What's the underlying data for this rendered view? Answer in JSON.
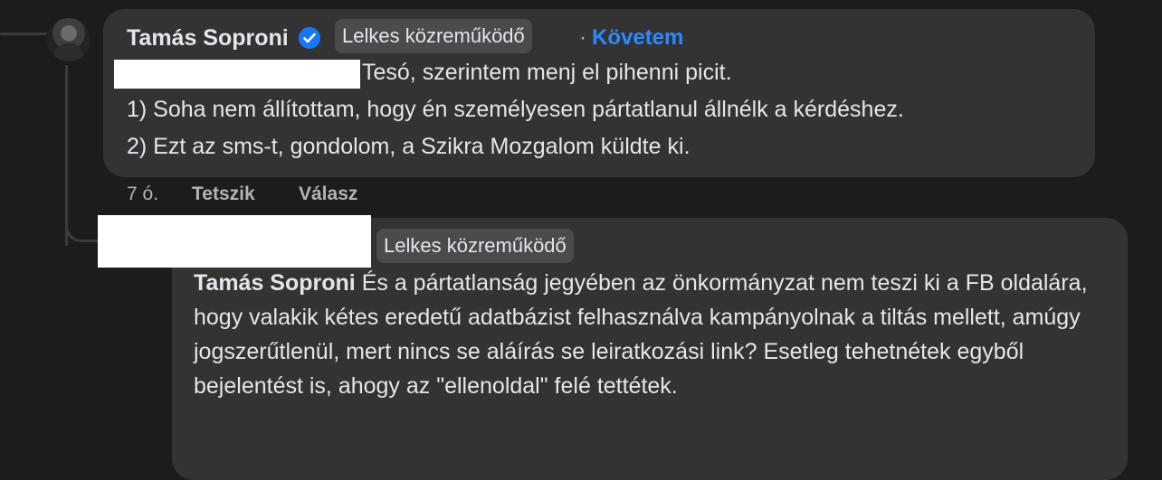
{
  "comment": {
    "author": "Tamás Soproni",
    "badge": "Lelkes közreműködő",
    "separator": "·",
    "follow_label": "Követem",
    "lines": [
      "Tesó, szerintem menj el pihenni picit.",
      "1) Soha nem állítottam, hogy én személyesen pártatlanul állnélk a kérdéshez.",
      "2) Ezt az sms-t, gondolom, a Szikra Mozgalom küldte ki."
    ],
    "time": "7 ó.",
    "like_label": "Tetszik",
    "reply_label": "Válasz"
  },
  "reply": {
    "badge": "Lelkes közreműködő",
    "mention": "Tamás Soproni",
    "text": " És a pártatlanság jegyében az önkormányzat nem teszi ki a FB oldalára, hogy valakik kétes eredetű adatbázist felhasználva kampányolnak a tiltás mellett, amúgy jogszerűtlenül, mert nincs se aláírás se leiratkozási link? Esetleg tehetnétek egyből bejelentést is, ahogy az \"ellenoldal\" felé tettétek."
  }
}
